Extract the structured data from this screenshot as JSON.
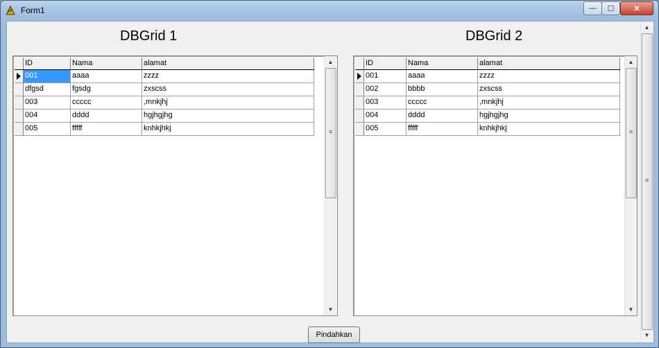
{
  "window": {
    "title": "Form1",
    "minimize_label": "—",
    "maximize_label": "☐",
    "close_label": "✕"
  },
  "headings": {
    "grid1": "DBGrid 1",
    "grid2": "DBGrid 2"
  },
  "columns": [
    "ID",
    "Nama",
    "alamat"
  ],
  "grid1": {
    "rows": [
      [
        "001",
        "aaaa",
        "zzzz"
      ],
      [
        "dfgsd",
        "fgsdg",
        "zxscss"
      ],
      [
        "003",
        "ccccc",
        ",mnkjhj"
      ],
      [
        "004",
        "dddd",
        "hgjhgjhg"
      ],
      [
        "005",
        "fffff",
        "knhkjhkj"
      ]
    ]
  },
  "grid2": {
    "rows": [
      [
        "001",
        "aaaa",
        "zzzz"
      ],
      [
        "002",
        "bbbb",
        "zxscss"
      ],
      [
        "003",
        "ccccc",
        ",mnkjhj"
      ],
      [
        "004",
        "dddd",
        "hgjhgjhg"
      ],
      [
        "005",
        "fffff",
        "knhkjhkj"
      ]
    ]
  },
  "buttons": {
    "move": "Pindahkan"
  },
  "icons": {
    "app": "delphi-form-icon",
    "scroll_up": "▲",
    "scroll_down": "▼",
    "grip": "≡"
  },
  "colors": {
    "selection": "#3399ff",
    "window_frame": "#a9c5e2",
    "close_button": "#c7432f"
  }
}
